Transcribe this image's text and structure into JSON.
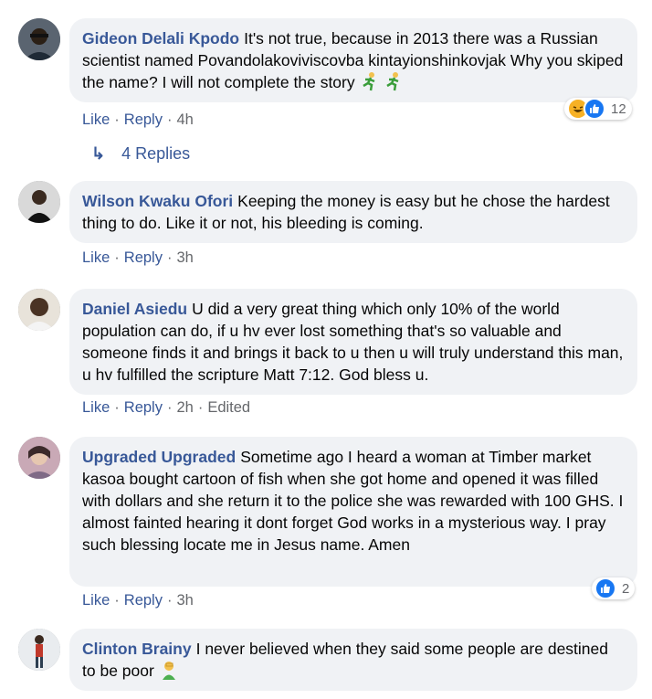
{
  "comments": [
    {
      "author": "Gideon Delali Kpodo",
      "text": "It's not true, because in 2013 there was a Russian scientist named Povandolakoviviscovba kintayionshinkovjak Why you skiped the name? I will not complete the story",
      "actions": {
        "like": "Like",
        "reply": "Reply",
        "time": "4h"
      },
      "reactions": {
        "count": "12",
        "icons": [
          "haha-icon",
          "like-icon"
        ]
      }
    },
    {
      "author": "Wilson Kwaku Ofori",
      "text": "Keeping the money is easy but he chose the hardest thing to do. Like it or not, his bleeding is coming.",
      "actions": {
        "like": "Like",
        "reply": "Reply",
        "time": "3h"
      }
    },
    {
      "author": "Daniel Asiedu",
      "text": "U did a very great thing which only 10% of the world population can do, if u hv ever lost something that's so valuable and someone finds it and brings it back to u then u will truly understand this man, u hv fulfilled the scripture Matt 7:12. God bless u.",
      "actions": {
        "like": "Like",
        "reply": "Reply",
        "time": "2h",
        "edited": "Edited"
      }
    },
    {
      "author": "Upgraded Upgraded",
      "text": "Sometime ago I heard a woman at Timber market kasoa bought cartoon of fish when she got home and opened it was filled with dollars and she return it to the police she was rewarded with 100 GHS. I almost fainted hearing it dont forget God works in a mysterious way. I pray such blessing locate me in Jesus name. Amen",
      "actions": {
        "like": "Like",
        "reply": "Reply",
        "time": "3h"
      },
      "reactions": {
        "count": "2",
        "icons": [
          "like-icon"
        ]
      }
    },
    {
      "author": "Clinton Brainy",
      "text": "I never believed when they said some people are destined to be poor"
    }
  ],
  "replies_label": "4 Replies",
  "sep": "·",
  "colors": {
    "link": "#385898",
    "bubble": "#f0f2f5",
    "meta": "#65676b",
    "like": "#1877f2"
  }
}
